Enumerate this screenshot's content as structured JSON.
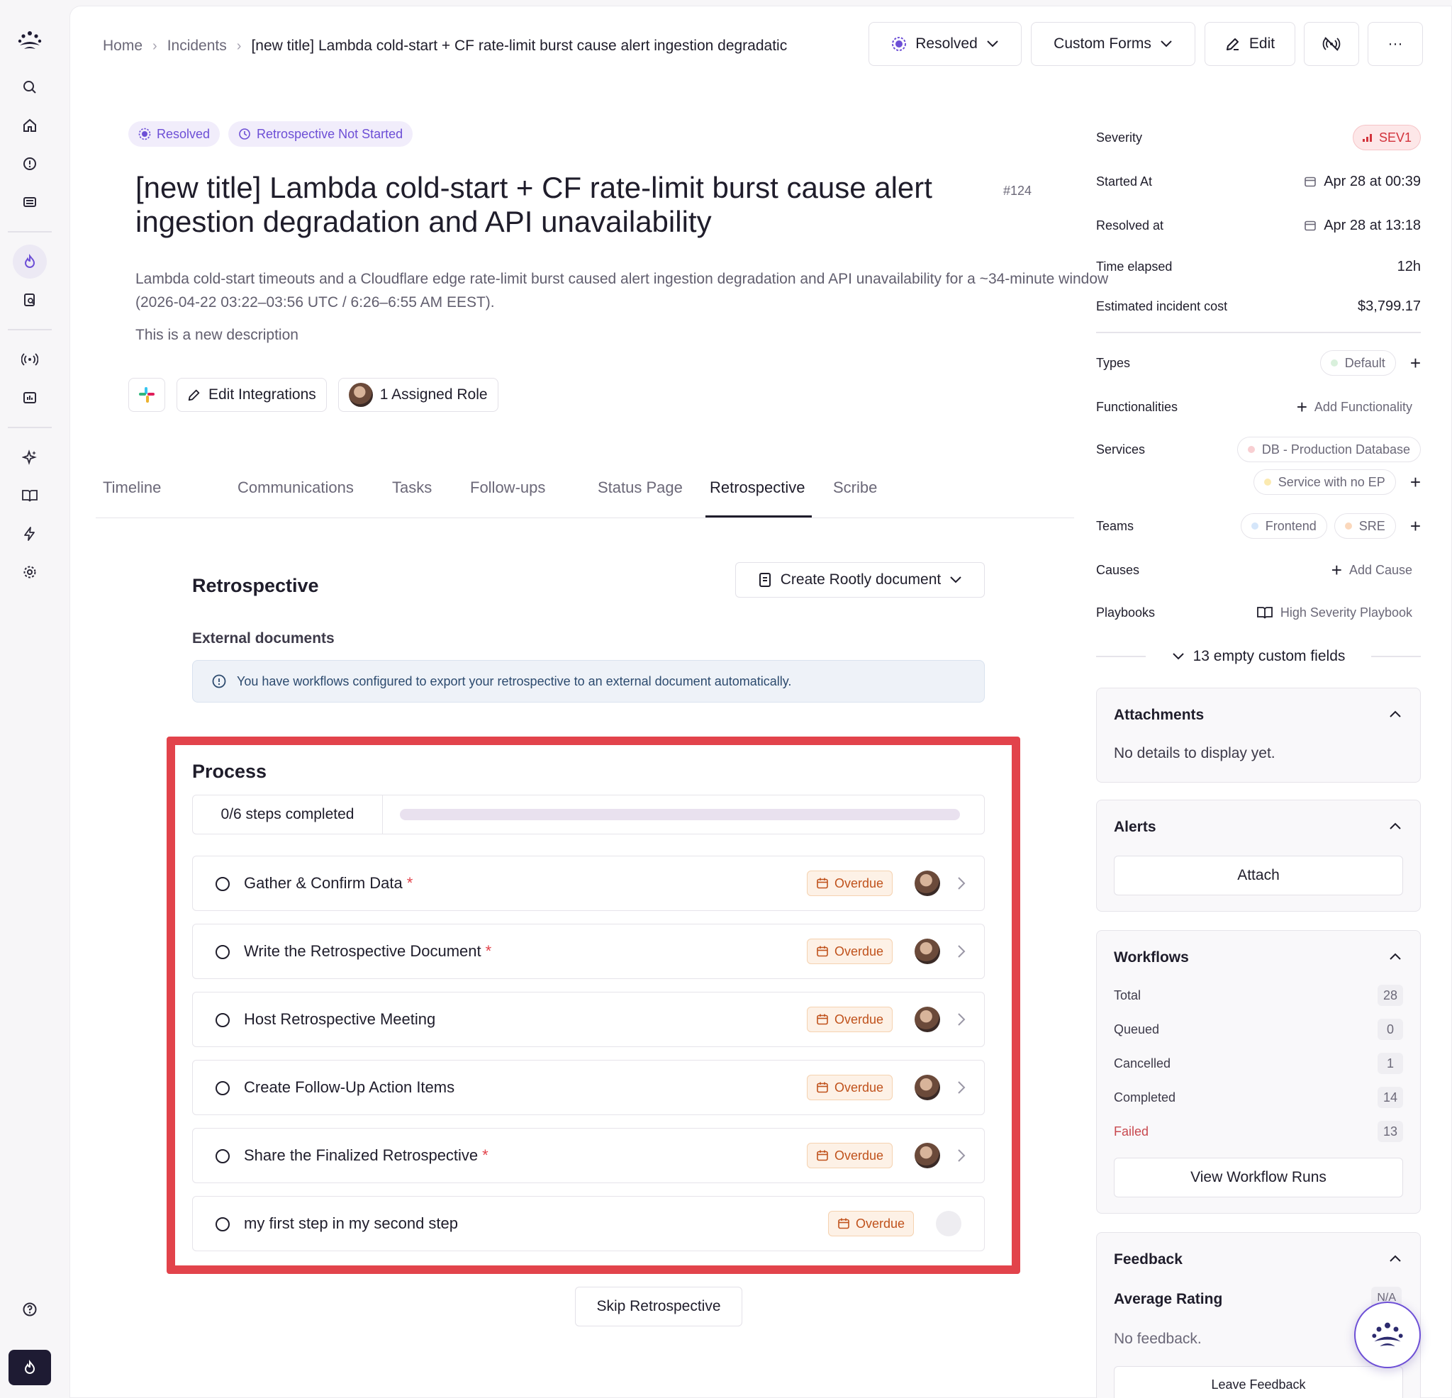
{
  "breadcrumb": {
    "home": "Home",
    "incidents": "Incidents",
    "current": "[new title] Lambda cold-start + CF rate-limit burst cause alert ingestion degradatic"
  },
  "topbar": {
    "status": "Resolved",
    "custom_forms": "Custom Forms",
    "edit": "Edit",
    "more": "···"
  },
  "badges": {
    "status": "Resolved",
    "retro": "Retrospective Not Started"
  },
  "incident": {
    "title": "[new title] Lambda cold-start + CF rate-limit burst cause alert ingestion degradation and API unavailability",
    "number": "#124",
    "description": "Lambda cold-start timeouts and a Cloudflare edge rate-limit burst caused alert ingestion degradation and API unavailability for a ~34-minute window (2026-04-22 03:22–03:56 UTC / 6:26–6:55 AM EEST).",
    "description2": "This is a new description"
  },
  "actions": {
    "edit_integrations": "Edit Integrations",
    "assigned_role": "1 Assigned Role"
  },
  "tabs": [
    "Timeline",
    "Communications",
    "Tasks",
    "Follow-ups",
    "Status Page",
    "Retrospective",
    "Scribe"
  ],
  "active_tab": "Retrospective",
  "retro": {
    "title": "Retrospective",
    "create_doc": "Create Rootly document",
    "external_title": "External documents",
    "info": "You have workflows configured to export your retrospective to an external document automatically.",
    "process_title": "Process",
    "progress_label": "0/6 steps completed",
    "progress_fraction": 0,
    "overdue_label": "Overdue",
    "steps": [
      {
        "name": "Gather & Confirm Data",
        "required": true,
        "assigned": true
      },
      {
        "name": "Write the Retrospective Document",
        "required": true,
        "assigned": true
      },
      {
        "name": "Host Retrospective Meeting",
        "required": false,
        "assigned": true
      },
      {
        "name": "Create Follow-Up Action Items",
        "required": false,
        "assigned": true
      },
      {
        "name": "Share the Finalized Retrospective",
        "required": true,
        "assigned": true
      },
      {
        "name": "my first step in my second step",
        "required": false,
        "assigned": false
      }
    ],
    "skip": "Skip Retrospective"
  },
  "sidebar": {
    "severity_label": "Severity",
    "severity_value": "SEV1",
    "started_label": "Started At",
    "started_value": "Apr 28 at 00:39",
    "resolved_label": "Resolved at",
    "resolved_value": "Apr 28 at 13:18",
    "elapsed_label": "Time elapsed",
    "elapsed_value": "12h",
    "cost_label": "Estimated incident cost",
    "cost_value": "$3,799.17",
    "types_label": "Types",
    "types_value": "Default",
    "functionalities_label": "Functionalities",
    "functionalities_value": "Add Functionality",
    "services_label": "Services",
    "service_1": "DB - Production Database",
    "service_2": "Service with no EP",
    "teams_label": "Teams",
    "team_1": "Frontend",
    "team_2": "SRE",
    "causes_label": "Causes",
    "causes_value": "Add Cause",
    "playbooks_label": "Playbooks",
    "playbooks_value": "High Severity Playbook",
    "empty_fields": "13 empty custom fields",
    "attachments_title": "Attachments",
    "attachments_body": "No details to display yet.",
    "alerts_title": "Alerts",
    "alerts_button": "Attach",
    "workflows_title": "Workflows",
    "workflows": [
      {
        "label": "Total",
        "count": "28"
      },
      {
        "label": "Queued",
        "count": "0"
      },
      {
        "label": "Cancelled",
        "count": "1"
      },
      {
        "label": "Completed",
        "count": "14"
      },
      {
        "label": "Failed",
        "count": "13"
      }
    ],
    "workflows_button": "View Workflow Runs",
    "feedback_title": "Feedback",
    "feedback_rating_label": "Average Rating",
    "feedback_rating_value": "N/A",
    "feedback_body": "No feedback.",
    "feedback_button": "Leave Feedback"
  },
  "colors": {
    "accent": "#6d4fd6",
    "highlight": "#e2434b",
    "overdue": "#c0521c",
    "sev": "#d2323b"
  }
}
